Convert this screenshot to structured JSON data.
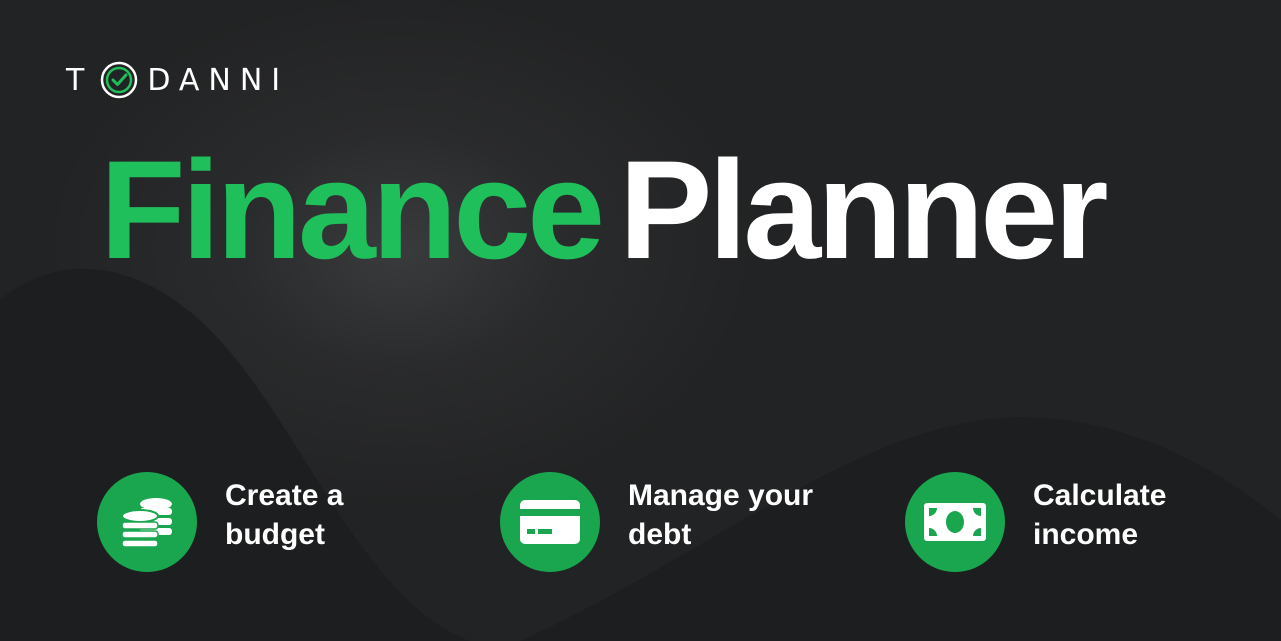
{
  "logo": {
    "before": "T",
    "after": "DANNI",
    "icon": "check-circle-icon"
  },
  "headline": {
    "word1": "Finance",
    "word2": "Planner"
  },
  "features": [
    {
      "line1": "Create a",
      "line2": "budget",
      "icon": "coins-icon"
    },
    {
      "line1": "Manage your",
      "line2": "debt",
      "icon": "credit-card-icon"
    },
    {
      "line1": "Calculate",
      "line2": "income",
      "icon": "money-bill-icon"
    }
  ],
  "colors": {
    "accent_green": "#1fbf5b",
    "background": "#222324",
    "text": "#ffffff"
  }
}
